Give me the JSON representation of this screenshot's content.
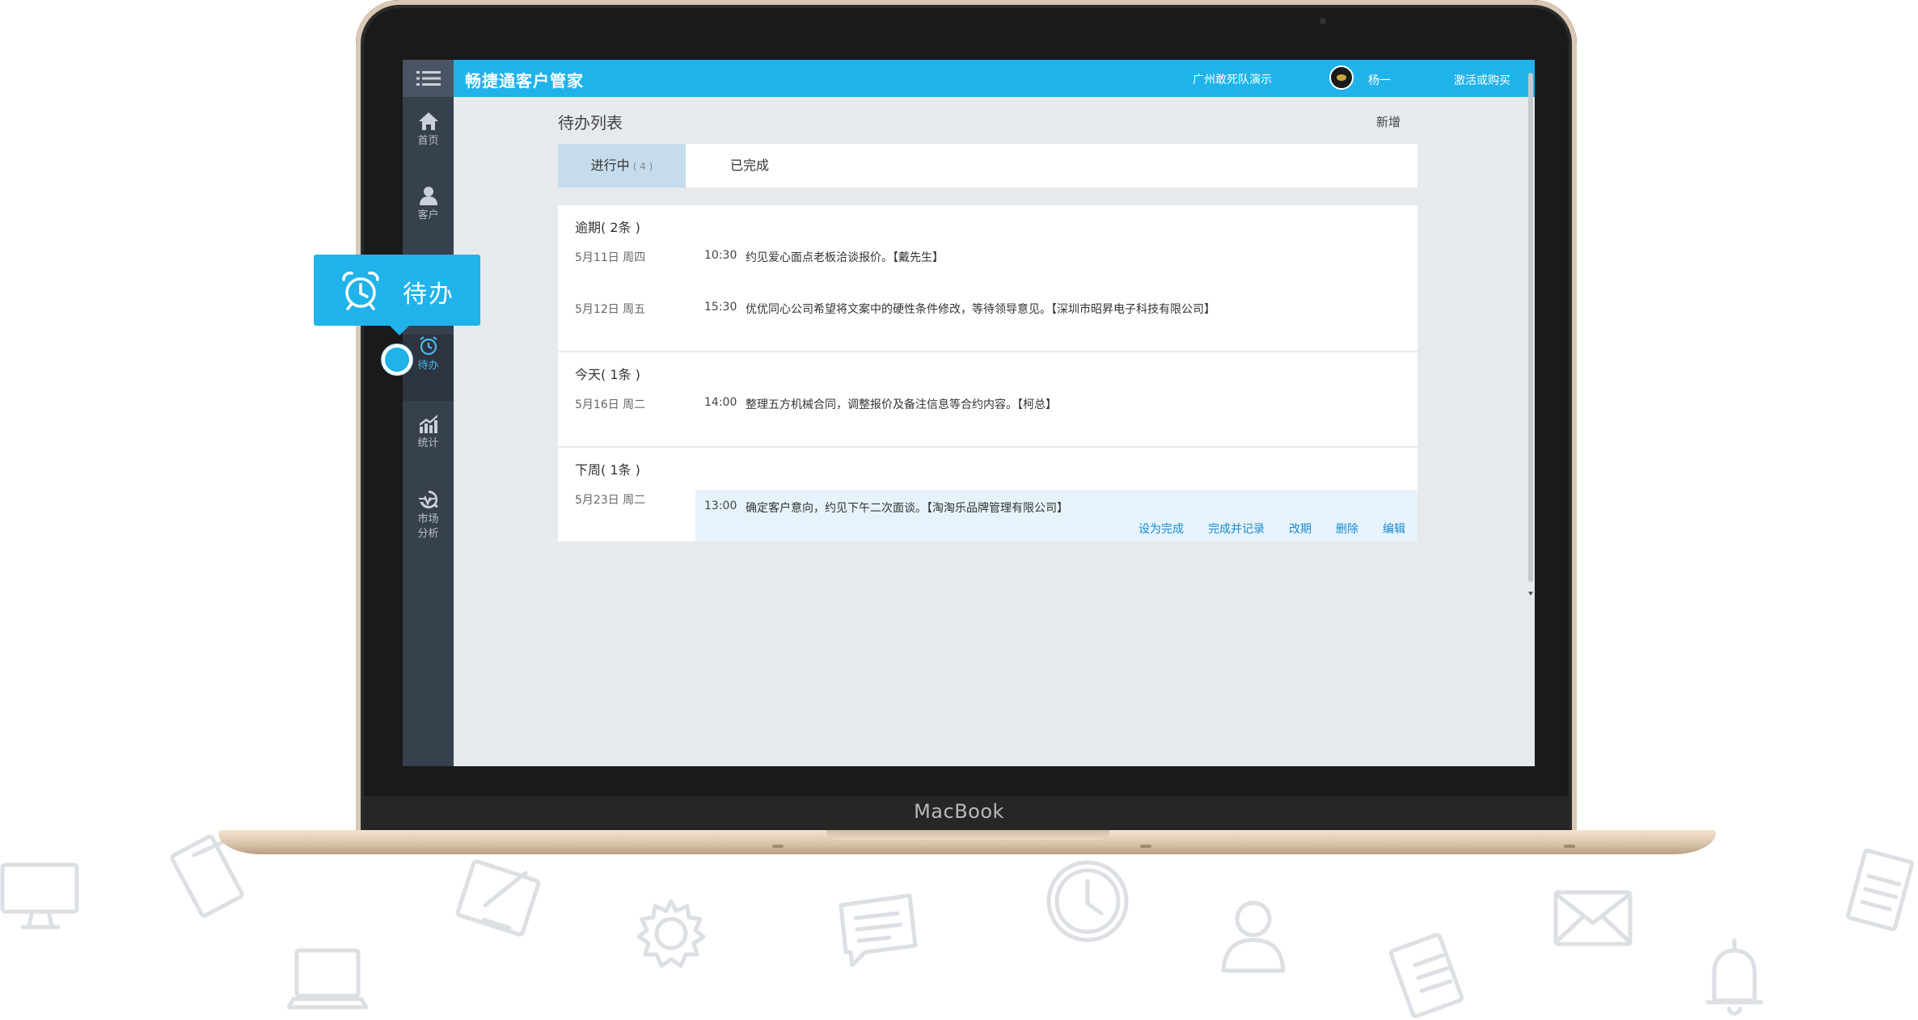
{
  "device": {
    "brand": "MacBook"
  },
  "sidebar": {
    "menu_icon": "hamburger-icon",
    "items": [
      {
        "label": "首页",
        "icon": "home-icon"
      },
      {
        "label": "客户",
        "icon": "user-icon"
      },
      {
        "label": "待办",
        "icon": "alarm-clock-icon",
        "active": true
      },
      {
        "label": "统计",
        "icon": "chart-icon"
      },
      {
        "label": "市场\n分析",
        "icon": "market-analysis-icon"
      }
    ]
  },
  "header": {
    "app_title": "畅捷通客户管家",
    "org_name": "广州敢死队演示",
    "user_name": "杨一",
    "activate_label": "激活或购买",
    "accent_color": "#1fb3ea"
  },
  "main": {
    "page_title": "待办列表",
    "add_label": "新增",
    "tabs": [
      {
        "label": "进行中",
        "count": "( 4 )"
      },
      {
        "label": "已完成"
      }
    ],
    "sections": [
      {
        "heading": "逾期( 2条 )",
        "items": [
          {
            "date": "5月11日 周四",
            "time": "10:30",
            "text": "约见爱心面点老板洽谈报价。【戴先生】"
          },
          {
            "date": "5月12日 周五",
            "time": "15:30",
            "text": "优优同心公司希望将文案中的硬性条件修改，等待领导意见。【深圳市昭昇电子科技有限公司】"
          }
        ]
      },
      {
        "heading": "今天( 1条 )",
        "items": [
          {
            "date": "5月16日 周二",
            "time": "14:00",
            "text": "整理五方机械合同，调整报价及备注信息等合约内容。【柯总】"
          }
        ]
      },
      {
        "heading": "下周( 1条 )",
        "items": [
          {
            "date": "5月23日 周二",
            "time": "13:00",
            "text": "确定客户意向，约见下午二次面谈。【淘淘乐品牌管理有限公司】"
          }
        ]
      }
    ],
    "row_actions": [
      "设为完成",
      "完成并记录",
      "改期",
      "删除",
      "编辑"
    ]
  },
  "callout": {
    "label": "待办",
    "icon": "alarm-clock-icon"
  },
  "background_icons": [
    "monitor-icon",
    "notebook-icon",
    "edit-document-icon",
    "gear-icon",
    "message-icon",
    "clock-icon",
    "person-icon",
    "clipboard-icon",
    "mail-icon",
    "document-icon",
    "laptop-icon",
    "bell-icon"
  ]
}
